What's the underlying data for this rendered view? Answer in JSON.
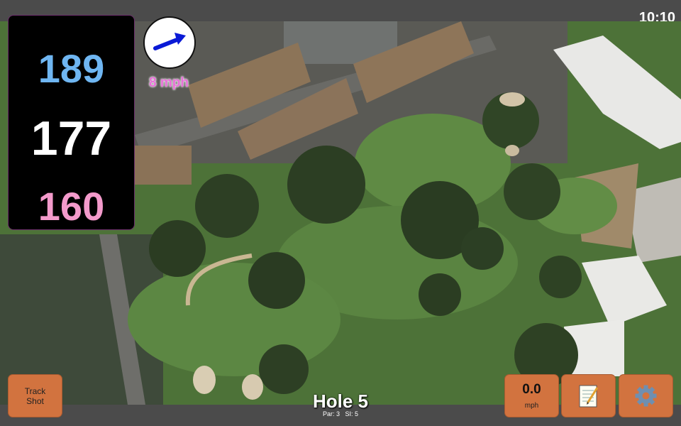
{
  "status": {
    "time": "10:10"
  },
  "distances": {
    "back": "189",
    "middle": "177",
    "front": "160"
  },
  "wind": {
    "speed_label": "8 mph",
    "direction_icon": "arrow-right-icon",
    "color": "#e870d8"
  },
  "hole": {
    "title": "Hole 5",
    "par_label": "Par: 3",
    "si_label": "SI: 5"
  },
  "buttons": {
    "track_shot_line1": "Track",
    "track_shot_line2": "Shot",
    "speed_value": "0.0",
    "speed_unit": "mph",
    "notes_icon": "notepad-icon",
    "settings_icon": "gear-icon"
  },
  "colors": {
    "button": "#d2733f",
    "back_distance": "#6fb6f2",
    "front_distance": "#f39acb",
    "panel": "#000000"
  }
}
